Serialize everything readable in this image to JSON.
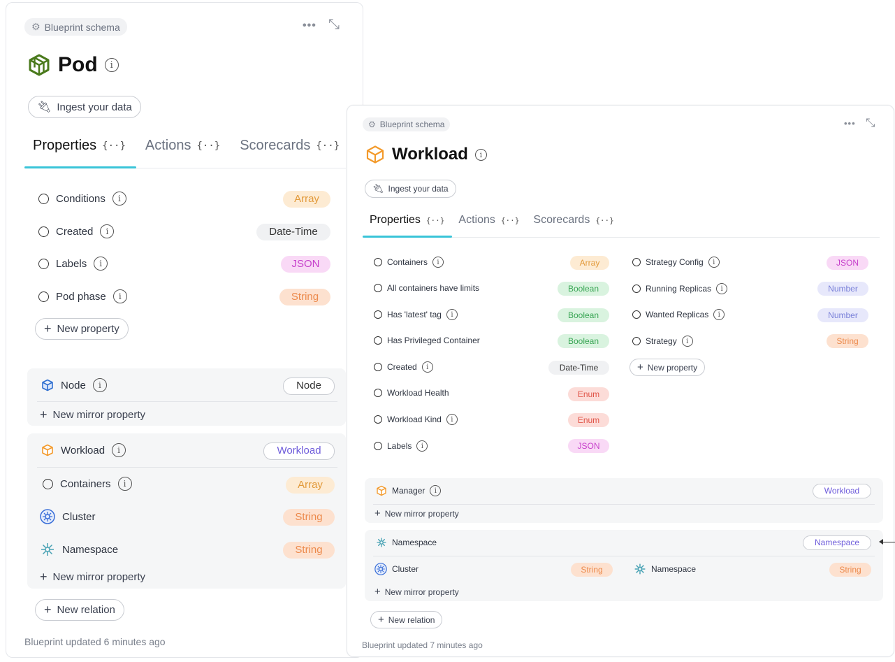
{
  "pod": {
    "schema_label": "Blueprint schema",
    "title": "Pod",
    "ingest_label": "Ingest your data",
    "tabs": [
      {
        "label": "Properties",
        "brace": "{··}"
      },
      {
        "label": "Actions",
        "brace": "{··}"
      },
      {
        "label": "Scorecards",
        "brace": "{··}"
      }
    ],
    "properties": [
      {
        "name": "Conditions",
        "type": "Array"
      },
      {
        "name": "Created",
        "type": "Date-Time"
      },
      {
        "name": "Labels",
        "type": "JSON"
      },
      {
        "name": "Pod phase",
        "type": "String"
      }
    ],
    "new_property_label": "New property",
    "relations": [
      {
        "name": "Node",
        "target": "Node",
        "mirror": [],
        "new_mirror_label": "New mirror property"
      },
      {
        "name": "Workload",
        "target": "Workload",
        "mirror": [
          {
            "name": "Containers",
            "type": "Array"
          },
          {
            "name": "Cluster",
            "type": "String"
          },
          {
            "name": "Namespace",
            "type": "String"
          }
        ],
        "new_mirror_label": "New mirror property"
      }
    ],
    "new_relation_label": "New relation",
    "footer": "Blueprint updated 6 minutes ago"
  },
  "workload": {
    "schema_label": "Blueprint schema",
    "title": "Workload",
    "ingest_label": "Ingest your data",
    "tabs": [
      {
        "label": "Properties",
        "brace": "{··}"
      },
      {
        "label": "Actions",
        "brace": "{··}"
      },
      {
        "label": "Scorecards",
        "brace": "{··}"
      }
    ],
    "properties_left": [
      {
        "name": "Containers",
        "type": "Array"
      },
      {
        "name": "All containers have limits",
        "type": "Boolean"
      },
      {
        "name": "Has 'latest' tag",
        "type": "Boolean"
      },
      {
        "name": "Has Privileged Container",
        "type": "Boolean"
      },
      {
        "name": "Created",
        "type": "Date-Time"
      },
      {
        "name": "Workload Health",
        "type": "Enum"
      },
      {
        "name": "Workload Kind",
        "type": "Enum"
      },
      {
        "name": "Labels",
        "type": "JSON"
      }
    ],
    "properties_right": [
      {
        "name": "Strategy Config",
        "type": "JSON"
      },
      {
        "name": "Running Replicas",
        "type": "Number"
      },
      {
        "name": "Wanted Replicas",
        "type": "Number"
      },
      {
        "name": "Strategy",
        "type": "String"
      }
    ],
    "new_property_label": "New property",
    "relations": [
      {
        "name": "Manager",
        "target": "Workload",
        "new_mirror_label": "New mirror property"
      },
      {
        "name": "Namespace",
        "target": "Namespace",
        "mirror": [
          {
            "name": "Cluster",
            "type": "String"
          },
          {
            "name": "Namespace",
            "type": "String"
          }
        ],
        "new_mirror_label": "New mirror property"
      }
    ],
    "new_relation_label": "New relation",
    "footer": "Blueprint updated 7 minutes ago"
  },
  "colors": {
    "tab_underline": "#3ac4d8",
    "pod_icon": "#4a7a1c",
    "workload_icon": "#f39a2b",
    "node_icon": "#2f6fd1",
    "cluster_icon": "#3a6fd8",
    "namespace_icon": "#4aa3b5"
  }
}
